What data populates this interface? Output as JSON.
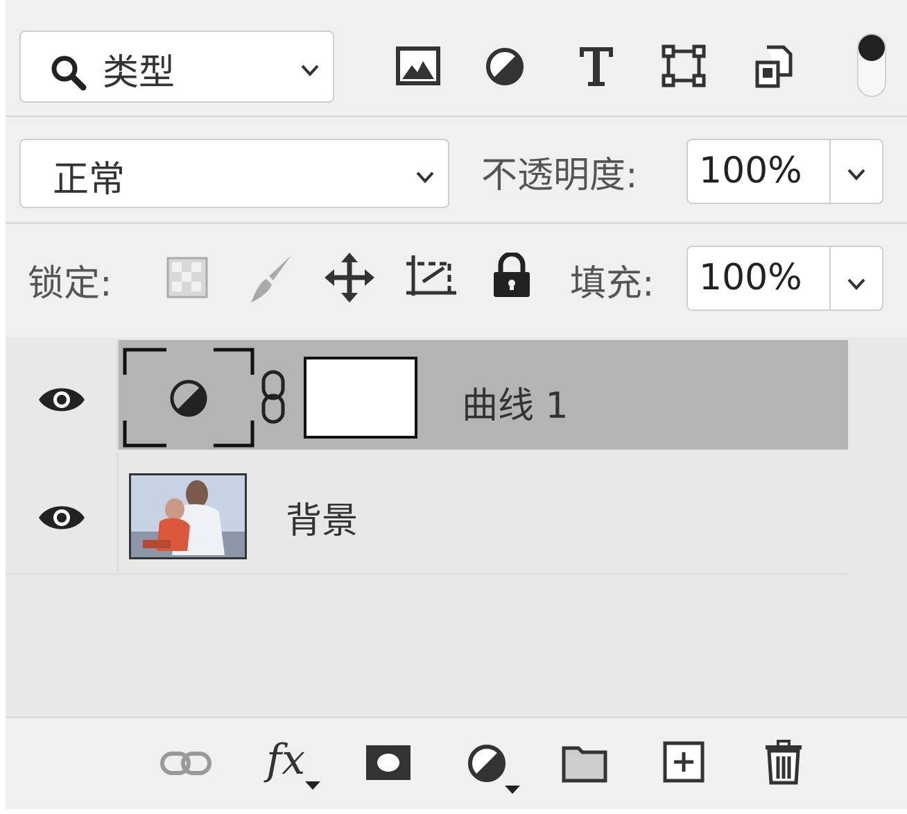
{
  "filter": {
    "type_label": "类型",
    "icons": [
      "search-icon",
      "chevron-down-icon",
      "image-filter-icon",
      "adjustment-filter-icon",
      "type-filter-icon",
      "shape-filter-icon",
      "smart-object-filter-icon",
      "filter-toggle-icon"
    ]
  },
  "blend": {
    "mode": "正常",
    "opacity_label": "不透明度:",
    "opacity_value": "100%"
  },
  "lock": {
    "label": "锁定:",
    "icons": [
      "lock-transparent-icon",
      "lock-paint-icon",
      "lock-move-icon",
      "lock-artboard-icon",
      "lock-all-icon"
    ],
    "fill_label": "填充:",
    "fill_value": "100%"
  },
  "layers": [
    {
      "name": "曲线 1",
      "kind": "adjustment",
      "visible": true,
      "selected": true,
      "icons": [
        "eye-icon",
        "curves-adjustment-icon",
        "chain-link-icon"
      ]
    },
    {
      "name": "背景",
      "kind": "image",
      "visible": true,
      "selected": false,
      "icons": [
        "eye-icon",
        "photo-thumbnail"
      ]
    }
  ],
  "bottom_bar": {
    "fx_label": "fx",
    "icons": [
      "link-layers-icon",
      "fx-icon",
      "add-mask-icon",
      "adjustment-layer-icon",
      "new-group-icon",
      "new-layer-icon",
      "trash-icon"
    ]
  },
  "colors": {
    "panel_bg": "#f0f0f0",
    "selected_row": "#b4b4b4",
    "row_bg": "#e8e8e8",
    "icon": "#333333"
  }
}
